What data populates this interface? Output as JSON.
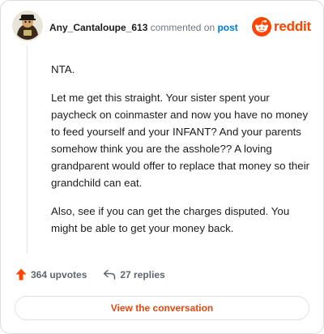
{
  "comment": {
    "author": "Any_Cantaloupe_613",
    "action": "commented on",
    "target": "post",
    "paragraphs": [
      "NTA.",
      "Let me get this straight. Your sister spent your paycheck on coinmaster and now you have no money to feed yourself and your INFANT? And your parents somehow think you are the asshole?? A loving grandparent would offer to replace that money so their grandchild can eat.",
      "Also, see if you can get the charges disputed. You might be able to get your money back."
    ],
    "upvotes": "364 upvotes",
    "replies": "27 replies"
  },
  "brand": {
    "name": "reddit",
    "color": "#ff4500"
  },
  "cta": {
    "label": "View the conversation"
  },
  "colors": {
    "accent": "#ff4500",
    "link": "#0079d3",
    "muted": "#6f7681",
    "button_text": "#e04a12"
  },
  "icons": {
    "avatar": "user-avatar",
    "logo": "reddit-logo-icon",
    "upvote": "upvote-arrow-icon",
    "reply": "reply-arrow-icon"
  }
}
